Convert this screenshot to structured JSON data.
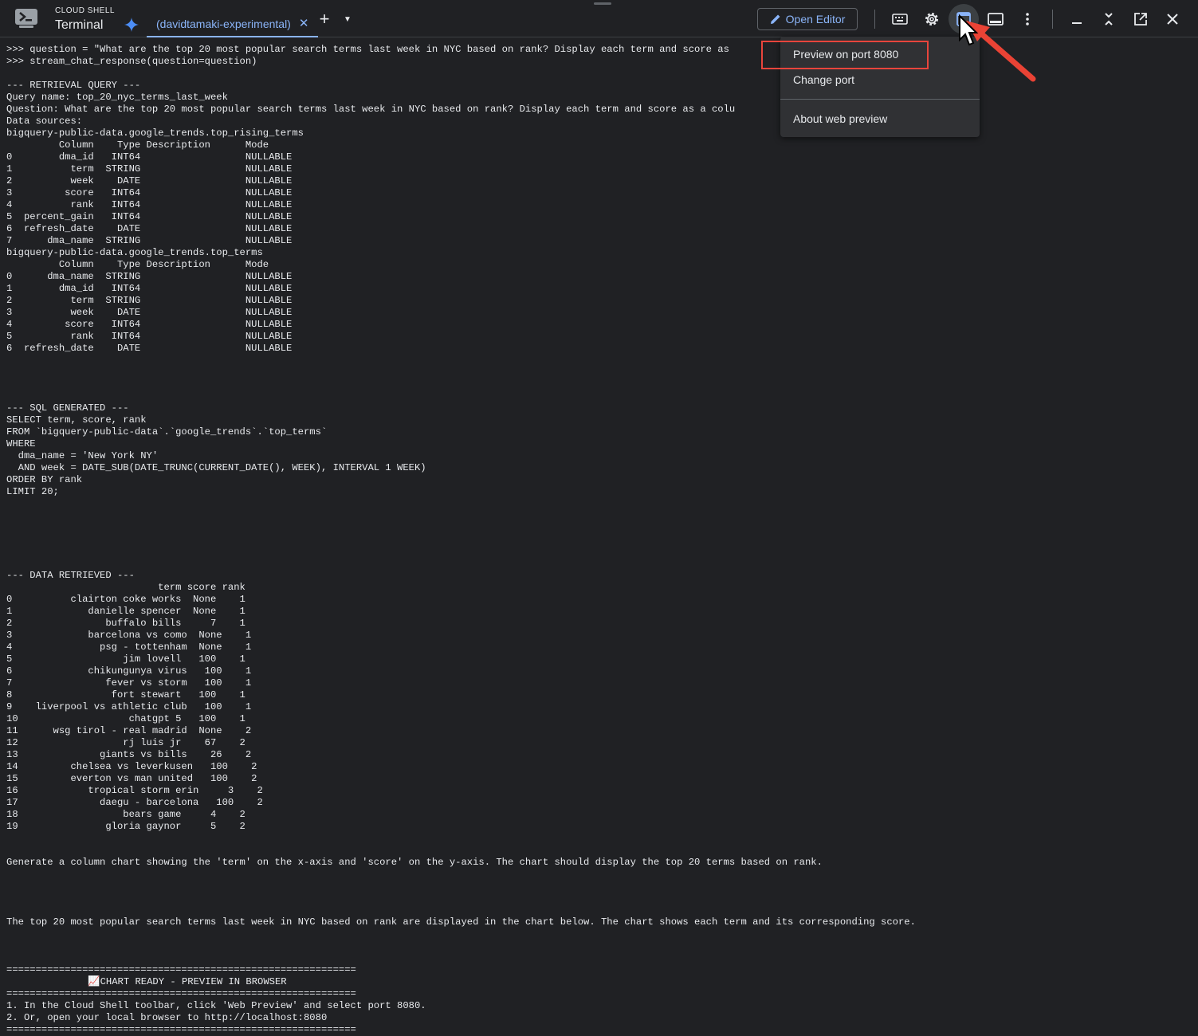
{
  "header": {
    "brand_sub": "CLOUD SHELL",
    "brand_title": "Terminal",
    "tab_label": "(davidtamaki-experimental)",
    "open_editor_label": "Open Editor"
  },
  "icons": {
    "app": "cloud-shell-terminal-icon",
    "gemini": "gemini-sparkle-icon",
    "tab_close": "close-icon",
    "new_tab": "plus-icon",
    "tab_menu": "caret-down-icon",
    "edit": "pencil-icon",
    "keyboard": "keyboard-icon",
    "settings": "gear-icon",
    "web_preview": "web-preview-icon",
    "layout": "panel-layout-icon",
    "more": "more-vertical-icon",
    "minimize": "minimize-icon",
    "restore": "collapse-icon",
    "open_new_window": "open-in-new-window-icon",
    "close": "close-icon"
  },
  "colors": {
    "accent": "#8ab4f8",
    "highlight": "#e8453c",
    "background": "#202124"
  },
  "menu": {
    "items": [
      "Preview on port 8080",
      "Change port",
      "About web preview"
    ]
  },
  "terminal": {
    "lines": [
      ">>> question = \"What are the top 20 most popular search terms last week in NYC based on rank? Display each term and score as",
      ">>> stream_chat_response(question=question)",
      "",
      "--- RETRIEVAL QUERY ---",
      "Query name: top_20_nyc_terms_last_week",
      "Question: What are the top 20 most popular search terms last week in NYC based on rank? Display each term and score as a colu",
      "Data sources:",
      "bigquery-public-data.google_trends.top_rising_terms",
      "         Column    Type Description      Mode",
      "0        dma_id   INT64                  NULLABLE",
      "1          term  STRING                  NULLABLE",
      "2          week    DATE                  NULLABLE",
      "3         score   INT64                  NULLABLE",
      "4          rank   INT64                  NULLABLE",
      "5  percent_gain   INT64                  NULLABLE",
      "6  refresh_date    DATE                  NULLABLE",
      "7      dma_name  STRING                  NULLABLE",
      "bigquery-public-data.google_trends.top_terms",
      "         Column    Type Description      Mode",
      "0      dma_name  STRING                  NULLABLE",
      "1        dma_id   INT64                  NULLABLE",
      "2          term  STRING                  NULLABLE",
      "3          week    DATE                  NULLABLE",
      "4         score   INT64                  NULLABLE",
      "5          rank   INT64                  NULLABLE",
      "6  refresh_date    DATE                  NULLABLE",
      "",
      "",
      "",
      "",
      "--- SQL GENERATED ---",
      "SELECT term, score, rank",
      "FROM `bigquery-public-data`.`google_trends`.`top_terms`",
      "WHERE",
      "  dma_name = 'New York NY'",
      "  AND week = DATE_SUB(DATE_TRUNC(CURRENT_DATE(), WEEK), INTERVAL 1 WEEK)",
      "ORDER BY rank",
      "LIMIT 20;",
      "",
      "",
      "",
      "",
      "",
      "",
      "--- DATA RETRIEVED ---",
      "                          term score rank",
      "0          clairton coke works  None    1",
      "1             danielle spencer  None    1",
      "2                buffalo bills     7    1",
      "3             barcelona vs como  None    1",
      "4               psg - tottenham  None    1",
      "5                   jim lovell   100    1",
      "6             chikungunya virus   100    1",
      "7                fever vs storm   100    1",
      "8                 fort stewart   100    1",
      "9    liverpool vs athletic club   100    1",
      "10                   chatgpt 5   100    1",
      "11      wsg tirol - real madrid  None    2",
      "12                  rj luis jr    67    2",
      "13              giants vs bills    26    2",
      "14         chelsea vs leverkusen   100    2",
      "15         everton vs man united   100    2",
      "16            tropical storm erin     3    2",
      "17              daegu - barcelona   100    2",
      "18                  bears game     4    2",
      "19               gloria gaynor     5    2",
      "",
      "",
      "Generate a column chart showing the 'term' on the x-axis and 'score' on the y-axis. The chart should display the top 20 terms based on rank.",
      "",
      "",
      "",
      "",
      "The top 20 most popular search terms last week in NYC based on rank are displayed in the chart below. The chart shows each term and its corresponding score.",
      "",
      "",
      "",
      "============================================================",
      "              📈CHART READY - PREVIEW IN BROWSER",
      "============================================================",
      "1. In the Cloud Shell toolbar, click 'Web Preview' and select port 8080.",
      "2. Or, open your local browser to http://localhost:8080",
      "============================================================"
    ]
  }
}
